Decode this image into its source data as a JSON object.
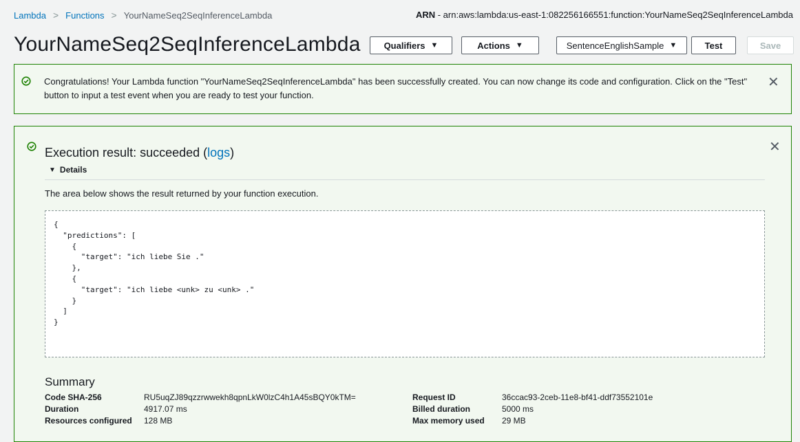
{
  "breadcrumb": {
    "items": [
      "Lambda",
      "Functions"
    ],
    "current": "YourNameSeq2SeqInferenceLambda",
    "separator": ">"
  },
  "arn": {
    "label": "ARN",
    "value": " - arn:aws:lambda:us-east-1:082256166551:function:YourNameSeq2SeqInferenceLambda"
  },
  "header": {
    "title": "YourNameSeq2SeqInferenceLambda",
    "qualifiers_label": "Qualifiers",
    "actions_label": "Actions",
    "test_event_selected": "SentenceEnglishSample",
    "test_label": "Test",
    "save_label": "Save",
    "caret": "▼"
  },
  "flash": {
    "message": "Congratulations! Your Lambda function \"YourNameSeq2SeqInferenceLambda\" has been successfully created. You can now change its code and configuration. Click on the \"Test\" button to input a test event when you are ready to test your function.",
    "close": "✕"
  },
  "execution": {
    "title_prefix": "Execution result: succeeded (",
    "logs_link": "logs",
    "title_suffix": ")",
    "details_label": "Details",
    "details_caret": "▼",
    "description": "The area below shows the result returned by your function execution.",
    "result_json": "{\n  \"predictions\": [\n    {\n      \"target\": \"ich liebe Sie .\"\n    },\n    {\n      \"target\": \"ich liebe <unk> zu <unk> .\"\n    }\n  ]\n}",
    "close": "✕"
  },
  "summary": {
    "heading": "Summary",
    "code_sha_label": "Code SHA-256",
    "code_sha_value": "RU5uqZJ89qzzrwwekh8qpnLkW0lzC4h1A45sBQY0kTM=",
    "duration_label": "Duration",
    "duration_value": "4917.07 ms",
    "resources_label": "Resources configured",
    "resources_value": "128 MB",
    "request_id_label": "Request ID",
    "request_id_value": "36ccac93-2ceb-11e8-bf41-ddf73552101e",
    "billed_label": "Billed duration",
    "billed_value": "5000 ms",
    "max_mem_label": "Max memory used",
    "max_mem_value": "29 MB"
  },
  "colors": {
    "success": "#1d8102",
    "link": "#0073bb",
    "success_bg": "#f2f8f0"
  },
  "icons": {
    "success": "check-circle-icon",
    "close": "close-icon",
    "breadcrumb_separator": "chevron-right-icon"
  }
}
